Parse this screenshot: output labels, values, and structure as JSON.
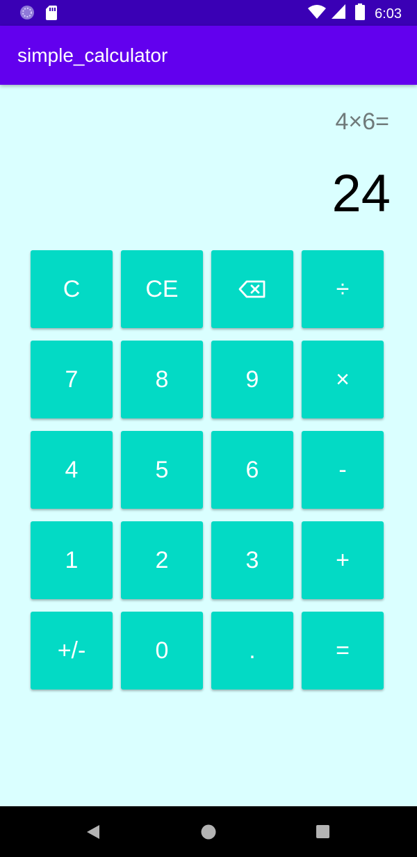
{
  "status_bar": {
    "time": "6:03",
    "icons": [
      "lens-notification-icon",
      "sd-card-icon",
      "wifi-icon",
      "signal-icon",
      "battery-icon"
    ]
  },
  "app_bar": {
    "title": "simple_calculator"
  },
  "display": {
    "expression": "4×6=",
    "result": "24"
  },
  "keypad": {
    "keys": [
      "C",
      "CE",
      "⌫",
      "÷",
      "7",
      "8",
      "9",
      "×",
      "4",
      "5",
      "6",
      "-",
      "1",
      "2",
      "3",
      "+",
      "+/-",
      "0",
      ".",
      "="
    ]
  },
  "nav_bar": {
    "icons": [
      "back-icon",
      "home-icon",
      "recents-icon"
    ]
  },
  "colors": {
    "status_bar": "#3a00b5",
    "app_bar": "#6200ee",
    "background": "#daffff",
    "key": "#03dac5",
    "expression_text": "#6f7a7a"
  }
}
